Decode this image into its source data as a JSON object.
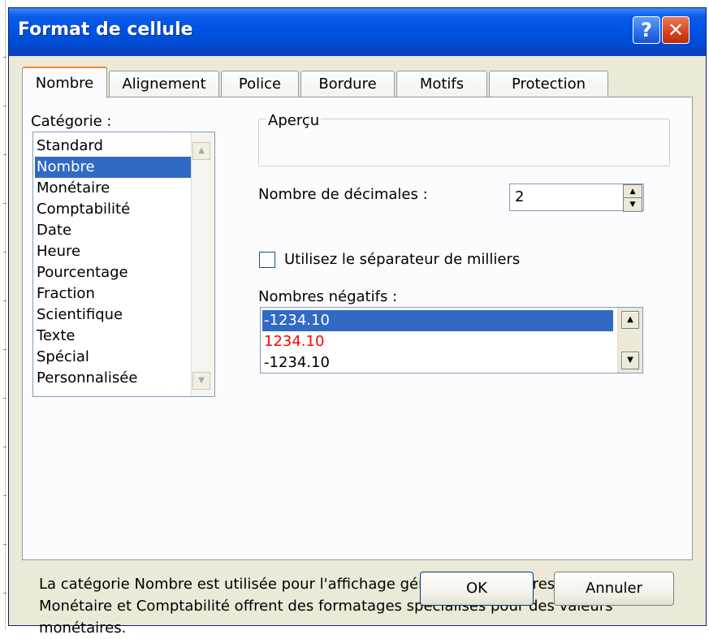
{
  "dialog": {
    "title": "Format de cellule",
    "help_button": "?",
    "close_button": "✕"
  },
  "tabs": [
    "Nombre",
    "Alignement",
    "Police",
    "Bordure",
    "Motifs",
    "Protection"
  ],
  "active_tab": "Nombre",
  "category": {
    "label": "Catégorie :",
    "items": [
      "Standard",
      "Nombre",
      "Monétaire",
      "Comptabilité",
      "Date",
      "Heure",
      "Pourcentage",
      "Fraction",
      "Scientifique",
      "Texte",
      "Spécial",
      "Personnalisée"
    ],
    "selected": "Nombre"
  },
  "preview": {
    "label": "Aperçu"
  },
  "decimals": {
    "label": "Nombre de décimales :",
    "value": "2"
  },
  "thousands_separator": {
    "label": "Utilisez le séparateur de milliers",
    "checked": false
  },
  "negatives": {
    "label": "Nombres négatifs :",
    "items": [
      "-1234.10",
      "1234.10",
      "-1234.10"
    ],
    "selected_index": 0,
    "red_index": 1
  },
  "description": "La catégorie Nombre est utilisée pour l'affichage général des nombres. Les catégories Monétaire et Comptabilité offrent des formatages spécialisés pour des valeurs monétaires.",
  "buttons": {
    "ok": "OK",
    "cancel": "Annuler"
  },
  "colors": {
    "selection": "#316ac5",
    "titlebar": "#0054e3",
    "red_value": "#ff0000",
    "dialog_bg": "#ece9d8"
  }
}
